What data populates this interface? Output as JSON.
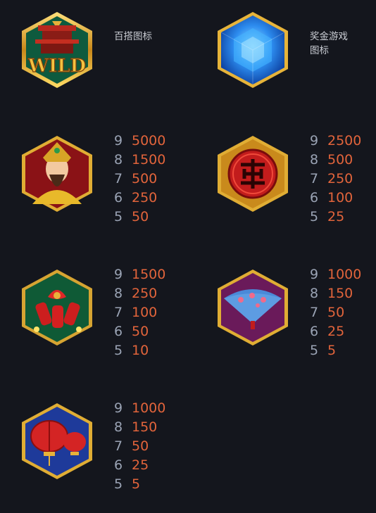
{
  "symbols": [
    {
      "id": "wild",
      "caption": "百搭图标",
      "payouts": []
    },
    {
      "id": "scatter",
      "caption": "奖金游戏图标",
      "payouts": []
    },
    {
      "id": "emperor",
      "payouts": [
        {
          "count": "9",
          "value": "5000"
        },
        {
          "count": "8",
          "value": "1500"
        },
        {
          "count": "7",
          "value": "500"
        },
        {
          "count": "6",
          "value": "250"
        },
        {
          "count": "5",
          "value": "50"
        }
      ]
    },
    {
      "id": "coin",
      "payouts": [
        {
          "count": "9",
          "value": "2500"
        },
        {
          "count": "8",
          "value": "500"
        },
        {
          "count": "7",
          "value": "250"
        },
        {
          "count": "6",
          "value": "100"
        },
        {
          "count": "5",
          "value": "25"
        }
      ]
    },
    {
      "id": "firecrackers",
      "payouts": [
        {
          "count": "9",
          "value": "1500"
        },
        {
          "count": "8",
          "value": "250"
        },
        {
          "count": "7",
          "value": "100"
        },
        {
          "count": "6",
          "value": "50"
        },
        {
          "count": "5",
          "value": "10"
        }
      ]
    },
    {
      "id": "fan",
      "payouts": [
        {
          "count": "9",
          "value": "1000"
        },
        {
          "count": "8",
          "value": "150"
        },
        {
          "count": "7",
          "value": "50"
        },
        {
          "count": "6",
          "value": "25"
        },
        {
          "count": "5",
          "value": "5"
        }
      ]
    },
    {
      "id": "lanterns",
      "payouts": [
        {
          "count": "9",
          "value": "1000"
        },
        {
          "count": "8",
          "value": "150"
        },
        {
          "count": "7",
          "value": "50"
        },
        {
          "count": "6",
          "value": "25"
        },
        {
          "count": "5",
          "value": "5"
        }
      ]
    }
  ],
  "wild_label": "WILD",
  "colors": {
    "background": "#14161d",
    "count_text": "#9aa3b4",
    "value_text": "#e2643b",
    "caption_text": "#c9ccd3",
    "frame_gold": "#d8a52c"
  }
}
